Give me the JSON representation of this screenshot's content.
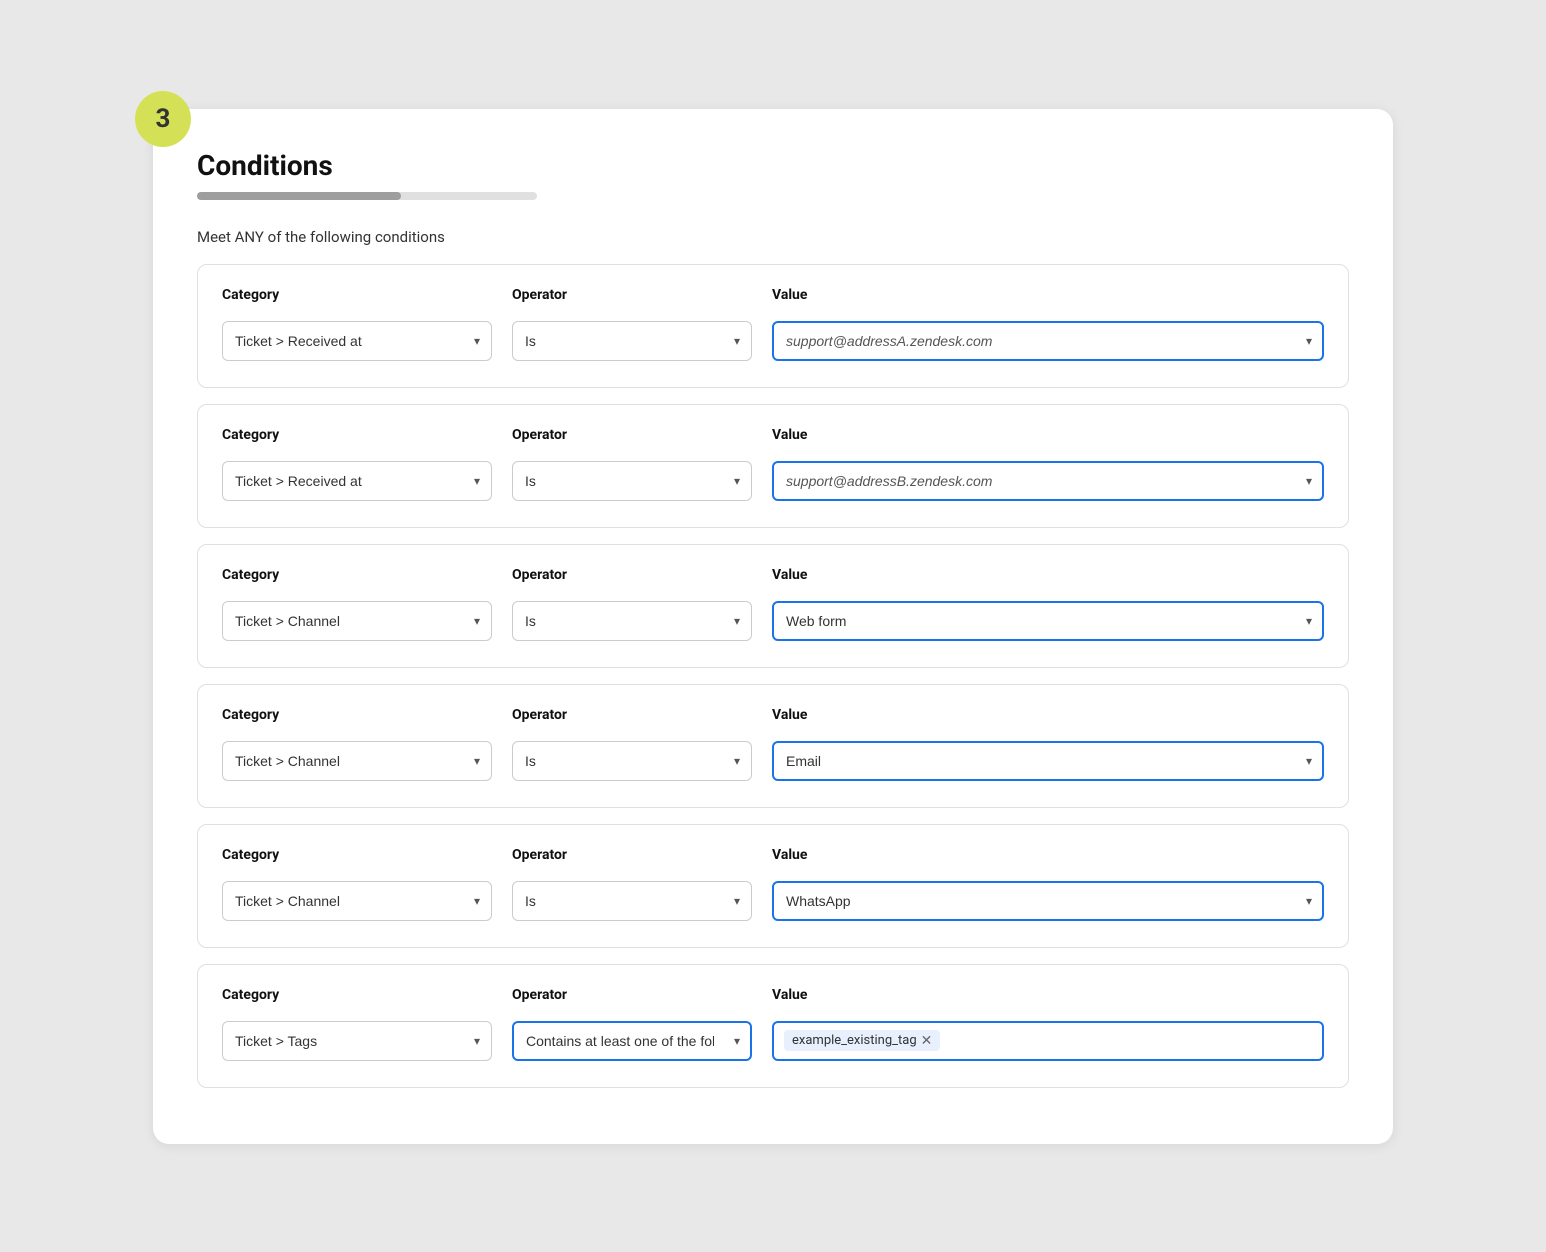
{
  "step": "3",
  "title": "Conditions",
  "section_label": "Meet ANY of the following conditions",
  "col_labels": {
    "category": "Category",
    "operator": "Operator",
    "value": "Value"
  },
  "conditions": [
    {
      "id": "cond-1",
      "category": "Ticket > Received at",
      "operator": "Is",
      "value": "support@addressA.zendesk.com",
      "value_style": "italic",
      "value_highlighted": true,
      "operator_highlighted": false,
      "type": "select"
    },
    {
      "id": "cond-2",
      "category": "Ticket > Received at",
      "operator": "Is",
      "value": "support@addressB.zendesk.com",
      "value_style": "italic",
      "value_highlighted": true,
      "operator_highlighted": false,
      "type": "select"
    },
    {
      "id": "cond-3",
      "category": "Ticket > Channel",
      "operator": "Is",
      "value": "Web form",
      "value_style": "normal",
      "value_highlighted": true,
      "operator_highlighted": false,
      "type": "select"
    },
    {
      "id": "cond-4",
      "category": "Ticket > Channel",
      "operator": "Is",
      "value": "Email",
      "value_style": "normal",
      "value_highlighted": true,
      "operator_highlighted": false,
      "type": "select"
    },
    {
      "id": "cond-5",
      "category": "Ticket > Channel",
      "operator": "Is",
      "value": "WhatsApp",
      "value_style": "normal",
      "value_highlighted": true,
      "operator_highlighted": false,
      "type": "select"
    },
    {
      "id": "cond-6",
      "category": "Ticket > Tags",
      "operator": "Contains at least one of the following",
      "value": "",
      "value_style": "normal",
      "value_highlighted": true,
      "operator_highlighted": true,
      "type": "tags",
      "tags": [
        "example_existing_tag"
      ]
    }
  ]
}
